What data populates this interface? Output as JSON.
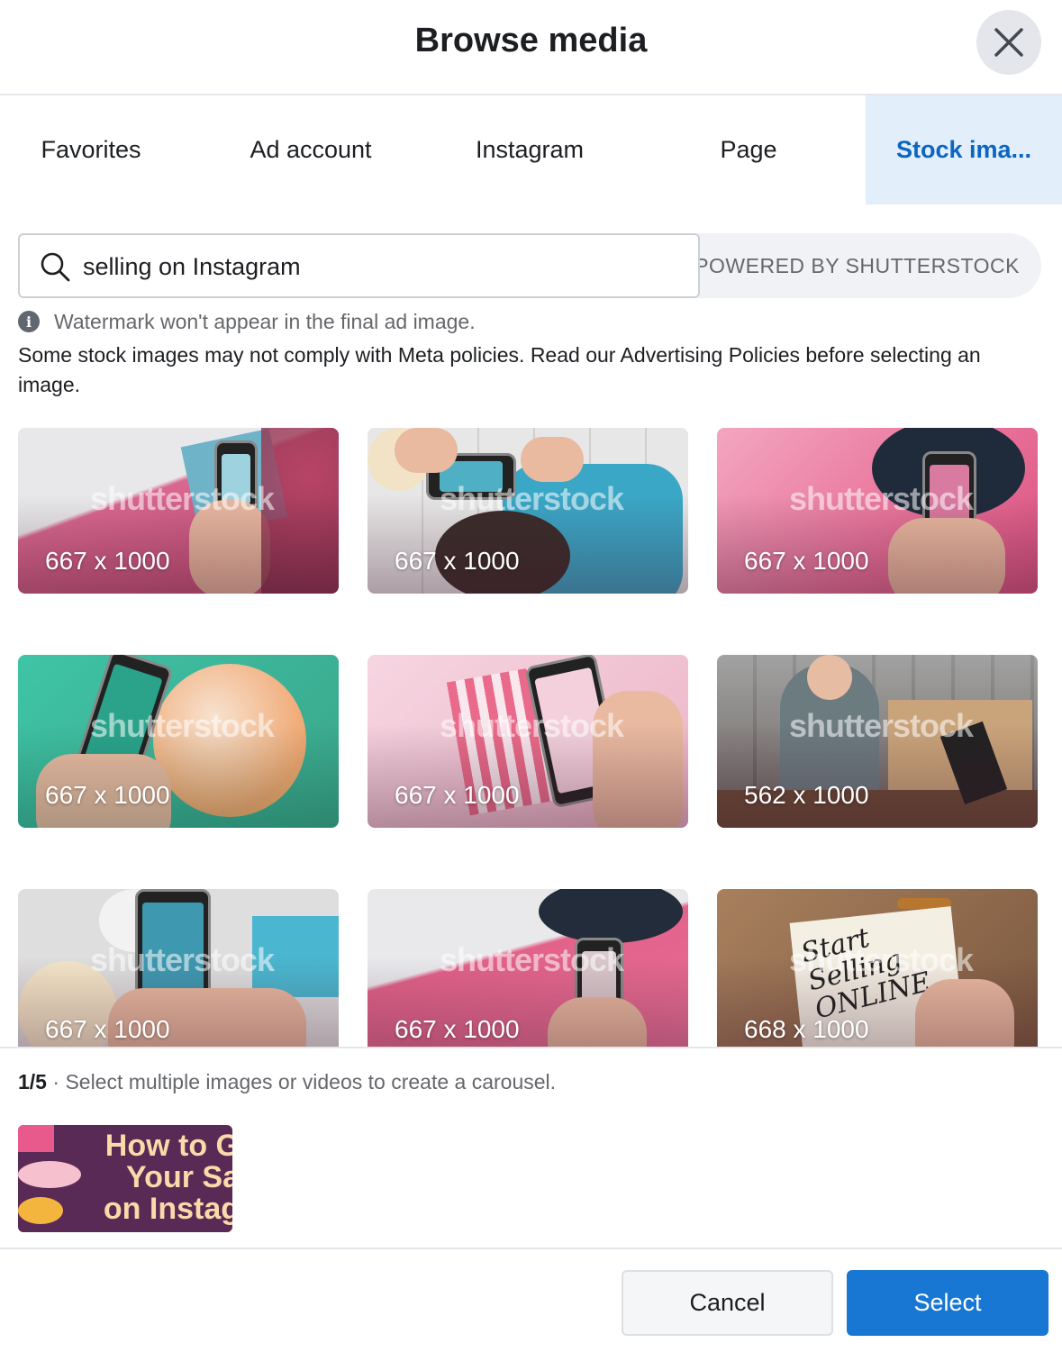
{
  "header": {
    "title": "Browse media"
  },
  "tabs": [
    {
      "label": "Favorites"
    },
    {
      "label": "Ad account"
    },
    {
      "label": "Instagram"
    },
    {
      "label": "Page"
    },
    {
      "label": "Stock ima..."
    }
  ],
  "active_tab": "Stock ima...",
  "search": {
    "value": "selling on Instagram",
    "powered_by": "POWERED BY SHUTTERSTOCK"
  },
  "notice": "Watermark won't appear in the final ad image.",
  "policy_text": "Some stock images may not comply with Meta policies. Read our Advertising Policies before selecting an image.",
  "images": [
    {
      "dimensions": "667 x 1000",
      "watermark": "shutterstock"
    },
    {
      "dimensions": "667 x 1000",
      "watermark": "shutterstock"
    },
    {
      "dimensions": "667 x 1000",
      "watermark": "shutterstock"
    },
    {
      "dimensions": "667 x 1000",
      "watermark": "shutterstock"
    },
    {
      "dimensions": "667 x 1000",
      "watermark": "shutterstock"
    },
    {
      "dimensions": "562 x 1000",
      "watermark": "shutterstock"
    },
    {
      "dimensions": "667 x 1000",
      "watermark": "shutterstock"
    },
    {
      "dimensions": "667 x 1000",
      "watermark": "shutterstock"
    },
    {
      "dimensions": "668 x 1000",
      "watermark": "shutterstock"
    }
  ],
  "selection": {
    "count": "1/5",
    "hint": "Select multiple images or videos to create a carousel.",
    "thumb_text": "How to G\nYour Sa\non Instag"
  },
  "buttons": {
    "cancel": "Cancel",
    "select": "Select"
  },
  "colors": {
    "accent": "#1877d2",
    "active_tab_bg": "#e2eefa",
    "active_tab_text": "#0a66c2"
  }
}
